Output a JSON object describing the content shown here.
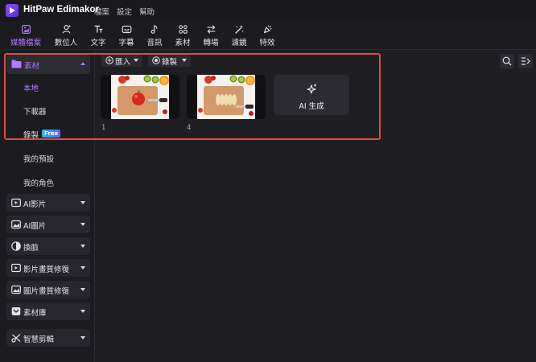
{
  "app": {
    "title": "HitPaw Edimakor",
    "menus": [
      "檔案",
      "設定",
      "幫助"
    ]
  },
  "toolbar": {
    "items": [
      {
        "label": "媒體檔案",
        "icon": "media-icon",
        "active": true
      },
      {
        "label": "數位人",
        "icon": "digital-human-icon",
        "active": false
      },
      {
        "label": "文字",
        "icon": "text-icon",
        "active": false
      },
      {
        "label": "字幕",
        "icon": "subtitle-icon",
        "active": false
      },
      {
        "label": "音訊",
        "icon": "audio-icon",
        "active": false
      },
      {
        "label": "素材",
        "icon": "material-icon",
        "active": false
      },
      {
        "label": "轉場",
        "icon": "transition-icon",
        "active": false
      },
      {
        "label": "濾鏡",
        "icon": "filter-icon",
        "active": false
      },
      {
        "label": "特效",
        "icon": "effects-icon",
        "active": false
      }
    ]
  },
  "sidebar": {
    "header": {
      "label": "素材",
      "icon": "folder-icon"
    },
    "subitems": [
      {
        "label": "本地",
        "active": true
      },
      {
        "label": "下載器",
        "active": false
      },
      {
        "label": "錄製",
        "active": false,
        "badge": "Free"
      },
      {
        "label": "我的預設",
        "active": false
      },
      {
        "label": "我的角色",
        "active": false
      }
    ],
    "groups": [
      {
        "label": "AI影片",
        "icon": "ai-video-icon"
      },
      {
        "label": "AI圖片",
        "icon": "ai-image-icon"
      },
      {
        "label": "換臉",
        "icon": "face-swap-icon"
      },
      {
        "label": "影片畫質修復",
        "icon": "video-enhance-icon"
      },
      {
        "label": "圖片畫質修復",
        "icon": "image-enhance-icon"
      },
      {
        "label": "素材庫",
        "icon": "library-icon"
      },
      {
        "label": "智慧剪輯",
        "icon": "smart-cut-icon"
      }
    ]
  },
  "main": {
    "import_label": "匯入",
    "record_label": "錄製",
    "thumbnails": [
      {
        "caption": "1"
      },
      {
        "caption": "4"
      }
    ],
    "ai_card_label": "AI 生成"
  },
  "colors": {
    "accent": "#b07cff",
    "highlight": "#e24a4a",
    "background": "#1e1e23"
  }
}
